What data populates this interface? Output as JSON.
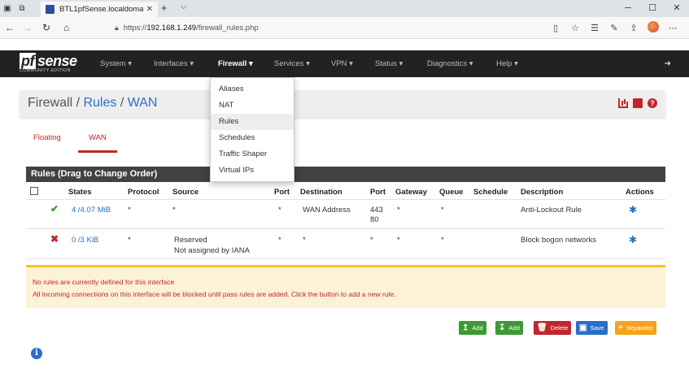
{
  "browser": {
    "tab_title": "BTL1pfSense.localdoma",
    "url_prefix": "https://",
    "url_host": "192.168.1.249",
    "url_path": "/firewall_rules.php"
  },
  "navbar": {
    "logo_word": "sense",
    "logo_pf": "pf",
    "logo_sub": "COMMUNITY EDITION",
    "menus": [
      "System ▾",
      "Interfaces ▾",
      "Firewall ▾",
      "Services ▾",
      "VPN ▾",
      "Status ▾",
      "Diagnostics ▾",
      "Help ▾"
    ]
  },
  "breadcrumb": {
    "root": "Firewall",
    "sep1": " / ",
    "mid": "Rules",
    "sep2": " / ",
    "leaf": "WAN"
  },
  "subtabs": [
    "Floating",
    "WAN"
  ],
  "rules": {
    "heading": "Rules (Drag to Change Order)",
    "columns": [
      "States",
      "Protocol",
      "Source",
      "Port",
      "Destination",
      "Port",
      "Gateway",
      "Queue",
      "Schedule",
      "Description",
      "Actions"
    ],
    "rows": [
      {
        "status": "✔",
        "states": "4 /4.07 MiB",
        "protocol": "*",
        "source": "*",
        "source2": "",
        "src_port": "*",
        "destination": "WAN Address",
        "dst_port": "443",
        "dst_port2": "80",
        "gateway": "*",
        "queue": "*",
        "schedule": "",
        "description": "Anti-Lockout Rule"
      },
      {
        "status": "✖",
        "states": "0 /3 KiB",
        "protocol": "*",
        "source": "Reserved",
        "source2": "Not assigned by IANA",
        "src_port": "*",
        "destination": "*",
        "dst_port": "*",
        "dst_port2": "",
        "gateway": "*",
        "queue": "*",
        "schedule": "",
        "description": "Block bogon networks"
      }
    ]
  },
  "alert": {
    "line1": "No rules are currently defined for this interface",
    "line2": "All incoming connections on this interface will be blocked until pass rules are added. Click the button to add a new rule."
  },
  "buttons": {
    "add_top": "Add",
    "add_bottom": "Add",
    "delete": "Delete",
    "save": "Save",
    "separator": "Separator"
  },
  "dropdown": {
    "items": [
      "Aliases",
      "NAT",
      "Rules",
      "Schedules",
      "Traffic Shaper",
      "Virtual IPs"
    ],
    "highlighted": "Rules"
  },
  "colors": {
    "accent_red": "#c0272d",
    "link_blue": "#2a6ec7",
    "success_green": "#3c9a32",
    "warning_orange": "#f7a21b",
    "navbar_dark": "#222222"
  }
}
